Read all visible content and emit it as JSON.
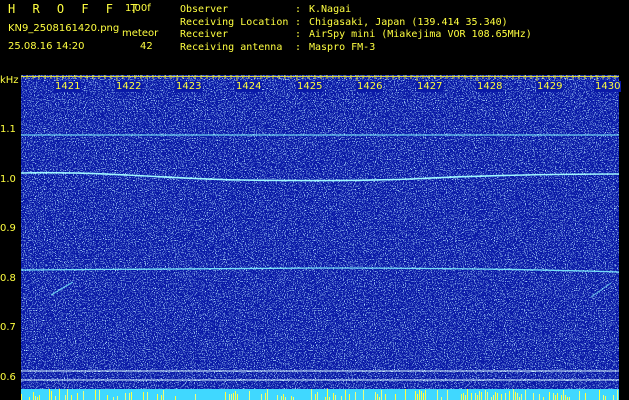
{
  "header": {
    "app_title": "H R O F F T",
    "version": "1.00f",
    "file_name": "KN9_2508161420.png",
    "mode_label": "meteor",
    "timestamp": "25.08.16 14:20",
    "count": "42",
    "info_rows": [
      {
        "key": "Observer",
        "value": "K.Nagai"
      },
      {
        "key": "Receiving Location",
        "value": "Chigasaki, Japan (139.414 35.340)"
      },
      {
        "key": "Receiver",
        "value": "AirSpy mini (Miakejima VOR 108.65MHz)"
      },
      {
        "key": "Receiving antenna",
        "value": "Maspro FM-3"
      }
    ]
  },
  "y_axis": {
    "unit": "kHz",
    "ticks": [
      "1.1",
      "1.0",
      "0.9",
      "0.8",
      "0.7",
      "0.6"
    ]
  },
  "x_axis": {
    "ticks": [
      "1421",
      "1422",
      "1423",
      "1424",
      "1425",
      "1426",
      "1427",
      "1428",
      "1429",
      "1430"
    ]
  },
  "colors": {
    "background": "#000000",
    "label": "#ffff40",
    "spectrum": "#0a1aa8",
    "trace": "#7ff0ff"
  }
}
